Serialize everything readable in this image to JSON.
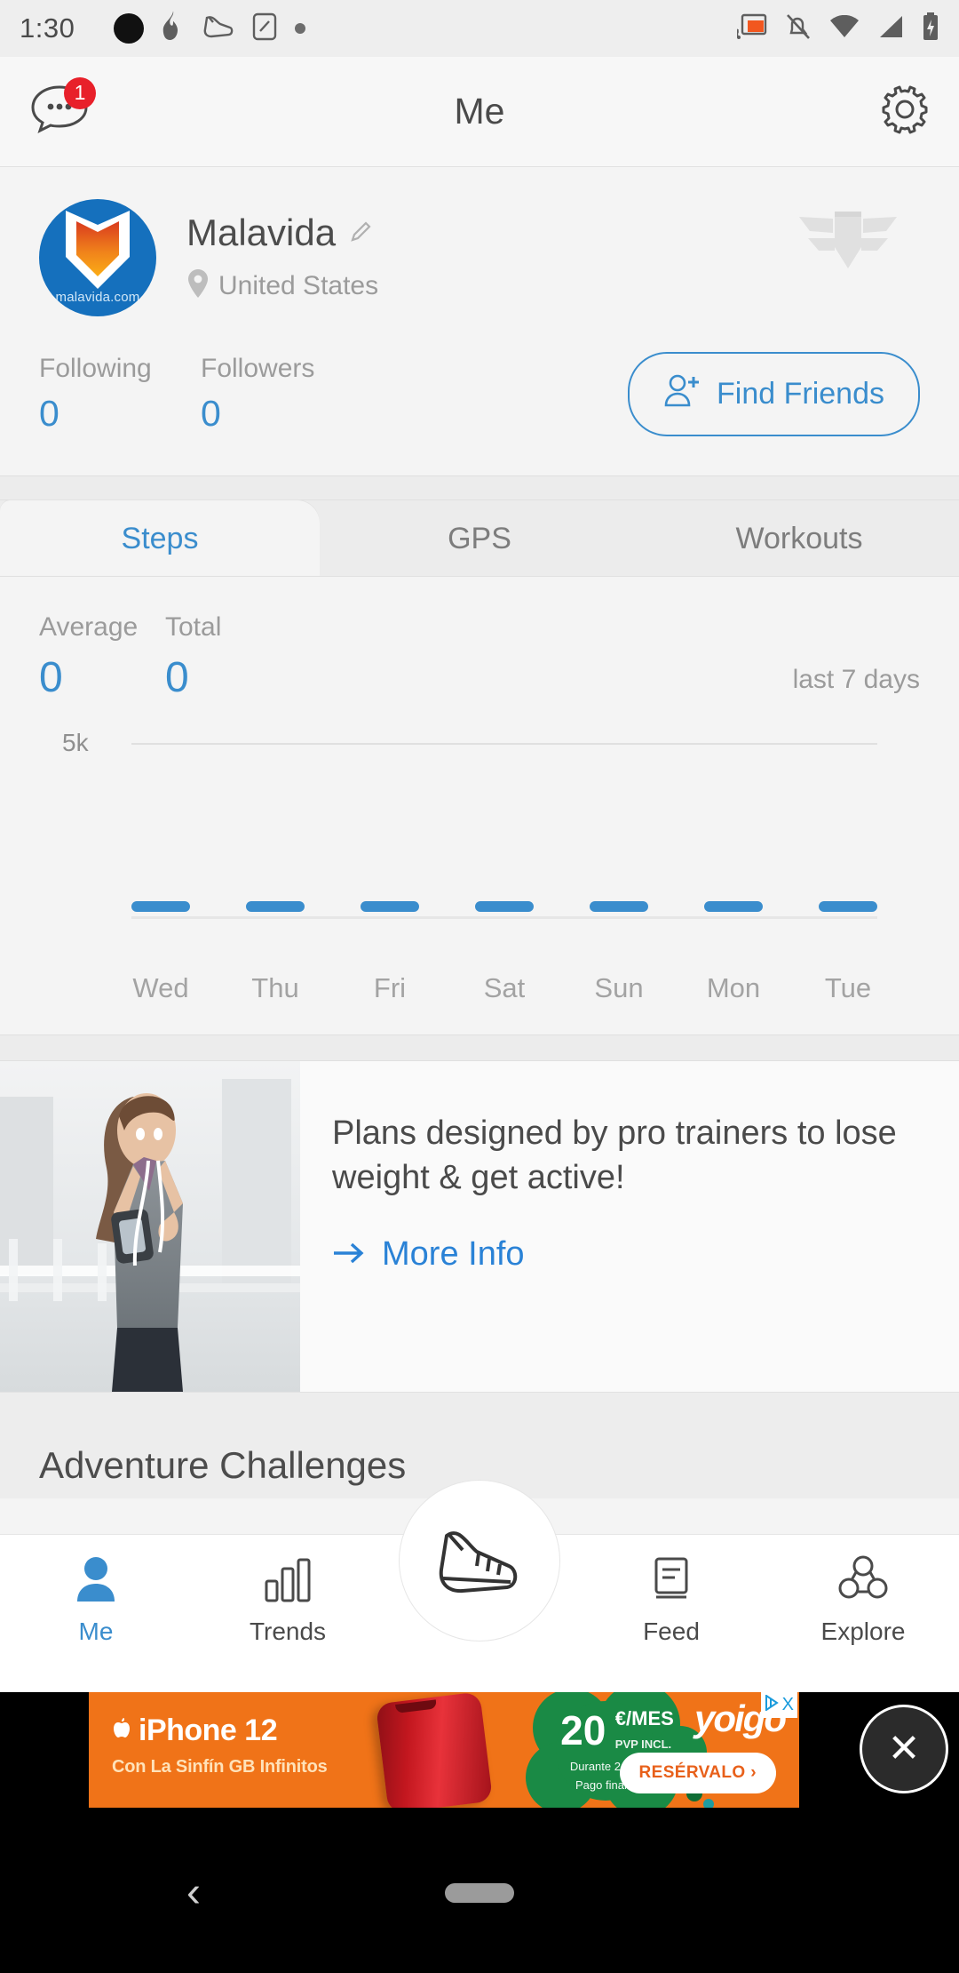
{
  "status_bar": {
    "time": "1:30",
    "left_icons": [
      "solid-circle-icon",
      "flame-icon",
      "shoe-icon",
      "screenshot-icon",
      "small-dot-icon"
    ],
    "right_icons": [
      "cast-icon",
      "notifications-muted-icon",
      "wifi-icon",
      "cellular-signal-icon",
      "battery-charging-icon"
    ]
  },
  "header": {
    "title": "Me",
    "chat_badge": "1",
    "chat_icon": "chat-bubble-icon",
    "settings_icon": "gear-icon"
  },
  "profile": {
    "username": "Malavida",
    "edit_icon": "pencil-icon",
    "location": "United States",
    "location_icon": "map-pin-icon",
    "avatar_domain": "malavida.com",
    "emblem_icon": "winged-shield-badge-icon",
    "following_label": "Following",
    "following_value": "0",
    "followers_label": "Followers",
    "followers_value": "0",
    "find_friends_label": "Find Friends",
    "find_friends_icon": "add-person-icon"
  },
  "tabs": [
    {
      "label": "Steps",
      "active": true
    },
    {
      "label": "GPS",
      "active": false
    },
    {
      "label": "Workouts",
      "active": false
    }
  ],
  "steps_panel": {
    "average_label": "Average",
    "average_value": "0",
    "total_label": "Total",
    "total_value": "0",
    "range_label": "last 7 days"
  },
  "chart_data": {
    "type": "bar",
    "title": "",
    "categories": [
      "Wed",
      "Thu",
      "Fri",
      "Sat",
      "Sun",
      "Mon",
      "Tue"
    ],
    "values": [
      0,
      0,
      0,
      0,
      0,
      0,
      0
    ],
    "ytick_labels": [
      "5k"
    ],
    "ylim": [
      0,
      5000
    ],
    "xlabel": "",
    "ylabel": "",
    "grid": true,
    "legend": "none",
    "bar_color": "#3a8dcd"
  },
  "promo": {
    "headline": "Plans designed by pro trainers to lose weight & get active!",
    "cta_label": "More Info",
    "cta_icon": "arrow-right-icon",
    "image_alt": "woman-running-photo"
  },
  "section": {
    "adventure_title": "Adventure Challenges"
  },
  "bottom_nav": {
    "items": [
      {
        "label": "Me",
        "icon": "person-icon",
        "active": true
      },
      {
        "label": "Trends",
        "icon": "bar-chart-icon",
        "active": false
      },
      {
        "label": "Feed",
        "icon": "feed-document-icon",
        "active": false
      },
      {
        "label": "Explore",
        "icon": "explore-cloud-icon",
        "active": false
      }
    ],
    "center_button_icon": "running-shoe-icon"
  },
  "ad": {
    "brand": "yoigo",
    "product": " iPhone 12",
    "subtitle": "Con La Sinfín GB Infinitos",
    "price": "20",
    "price_unit": "€/MES",
    "price_note": "PVP INCL.",
    "terms_line1": "Durante 24 meses",
    "terms_line2": "Pago final 249 €",
    "cta": "RESÉRVALO ›",
    "adchoices_label": "X",
    "close_label": "✕"
  },
  "android_nav": {
    "back_icon": "back-chevron-icon",
    "home_pill": "home-pill-icon"
  },
  "colors": {
    "accent_blue": "#3a8dcd",
    "badge_red": "#e8202a",
    "ad_orange": "#f07318",
    "ad_green": "#1a8a45"
  }
}
